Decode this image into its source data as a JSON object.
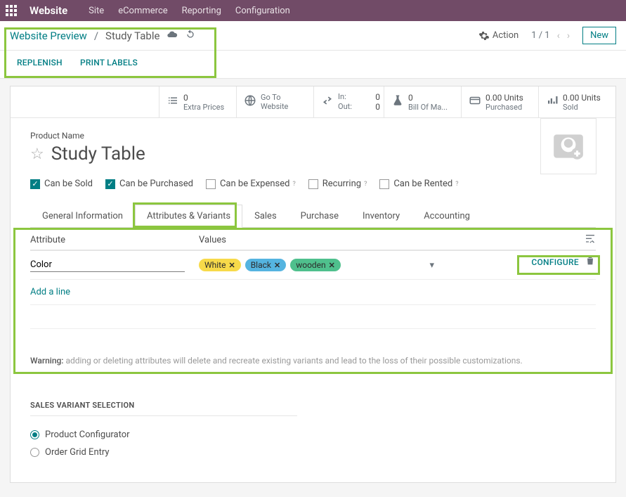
{
  "topbar": {
    "brand": "Website",
    "menu": [
      "Site",
      "eCommerce",
      "Reporting",
      "Configuration"
    ]
  },
  "breadcrumb": {
    "link": "Website Preview",
    "current": "Study Table"
  },
  "actions": {
    "gear_label": "Action",
    "pager": "1 / 1",
    "new_btn": "New"
  },
  "actionbar": {
    "replenish": "REPLENISH",
    "print_labels": "PRINT LABELS"
  },
  "stats": {
    "extra_prices": {
      "num": "0",
      "label": "Extra Prices"
    },
    "goto_website": {
      "label": "Go To Website"
    },
    "inout": {
      "in_label": "In:",
      "in_val": "0",
      "out_label": "Out:",
      "out_val": "0"
    },
    "bom": {
      "num": "0",
      "label": "Bill Of Ma..."
    },
    "purchased": {
      "num": "0.00 Units",
      "label": "Purchased"
    },
    "sold": {
      "num": "0.00 Units",
      "label": "Sold"
    }
  },
  "product": {
    "name_label": "Product Name",
    "name": "Study Table"
  },
  "checks": {
    "sold": "Can be Sold",
    "purchased": "Can be Purchased",
    "expensed": "Can be Expensed",
    "recurring": "Recurring",
    "rented": "Can be Rented"
  },
  "tabs": [
    "General Information",
    "Attributes & Variants",
    "Sales",
    "Purchase",
    "Inventory",
    "Accounting"
  ],
  "attrs": {
    "head_attribute": "Attribute",
    "head_values": "Values",
    "row_attr": "Color",
    "tags": {
      "white": "White",
      "black": "Black",
      "wooden": "wooden"
    },
    "configure": "CONFIGURE",
    "add_line": "Add a line",
    "warning_label": "Warning:",
    "warning_text": " adding or deleting attributes will delete and recreate existing variants and lead to the loss of their possible customizations."
  },
  "sales_sel": {
    "title": "SALES VARIANT SELECTION",
    "opt1": "Product Configurator",
    "opt2": "Order Grid Entry"
  }
}
